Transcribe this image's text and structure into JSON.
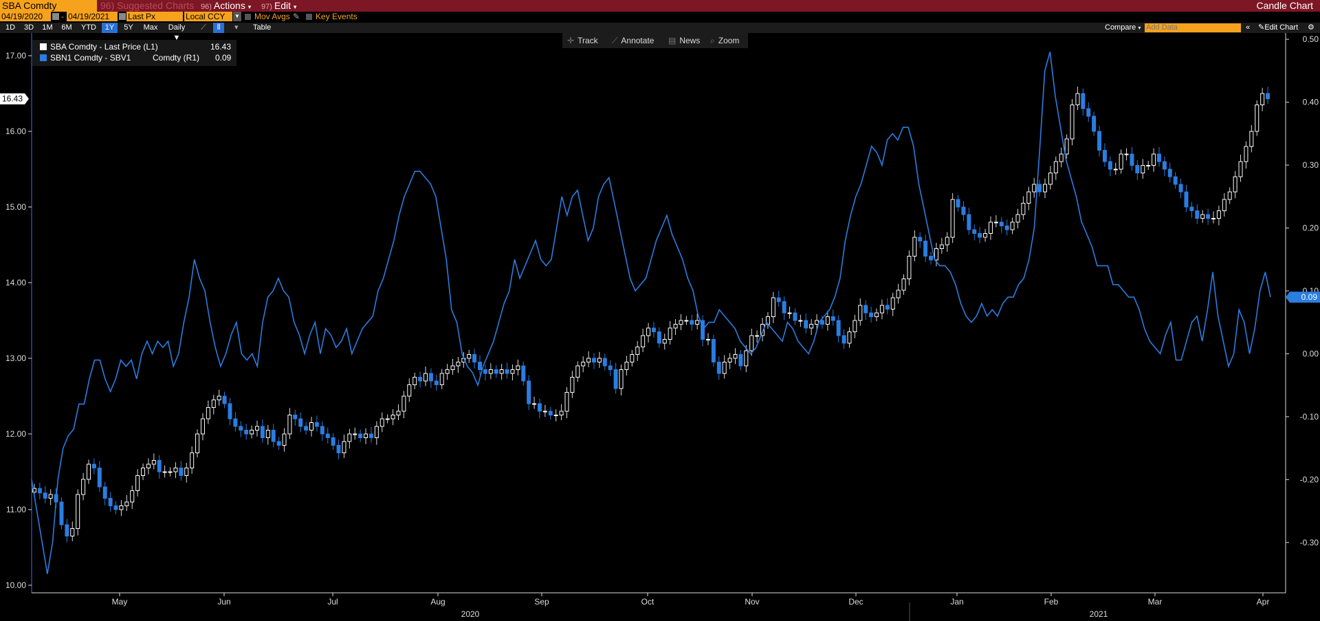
{
  "header": {
    "ticker": "SBA Comdty",
    "suggested_num": "96)",
    "suggested_label": "Suggested Charts",
    "actions_num": "96)",
    "actions_label": "Actions",
    "edit_num": "97)",
    "edit_label": "Edit",
    "title": "Candle Chart"
  },
  "options": {
    "start_date": "04/19/2020",
    "end_date": "04/19/2021",
    "field": "Last Px",
    "currency": "Local CCY",
    "mov_avgs": "Mov Avgs",
    "key_events": "Key Events"
  },
  "range_bar": {
    "ranges": [
      "1D",
      "3D",
      "1M",
      "6M",
      "YTD",
      "1Y",
      "5Y",
      "Max"
    ],
    "selected": "1Y",
    "frequency": "Daily",
    "table": "Table",
    "compare": "Compare",
    "add_data_placeholder": "Add Data",
    "edit_chart": "Edit Chart"
  },
  "toolbar": {
    "track": "Track",
    "annotate": "Annotate",
    "news": "News",
    "zoom": "Zoom"
  },
  "legend": [
    {
      "label": "SBA Comdty - Last Price (L1)",
      "value": "16.43",
      "color": "#ffffff"
    },
    {
      "label": "SBN1 Comdty - SBV1",
      "unit": "Comdty (R1)",
      "value": "0.09",
      "color": "#2a7de1"
    }
  ],
  "chart_data": {
    "type": "candlestick",
    "left_axis": {
      "ticks": [
        "10.00",
        "11.00",
        "12.00",
        "13.00",
        "14.00",
        "15.00",
        "16.00",
        "17.00"
      ],
      "range": [
        9.9,
        17.3
      ],
      "last_value_label": "16.43"
    },
    "right_axis": {
      "ticks": [
        "-0.30",
        "-0.20",
        "-0.10",
        "0.00",
        "0.10",
        "0.20",
        "0.30",
        "0.40",
        "0.50"
      ],
      "range": [
        -0.38,
        0.51
      ],
      "last_value_label": "0.09"
    },
    "x_months": [
      "May",
      "Jun",
      "Jul",
      "Aug",
      "Sep",
      "Oct",
      "Nov",
      "Dec",
      "Jan",
      "Feb",
      "Mar",
      "Apr"
    ],
    "x_years": [
      "2020",
      "2021"
    ],
    "series": [
      {
        "name": "SBA Comdty - Last Price (L1)",
        "axis": "left",
        "close": [
          11.28,
          11.22,
          11.15,
          11.2,
          11.1,
          10.8,
          10.65,
          10.75,
          11.2,
          11.4,
          11.6,
          11.55,
          11.3,
          11.15,
          11.05,
          11.0,
          11.05,
          11.1,
          11.25,
          11.45,
          11.55,
          11.6,
          11.65,
          11.5,
          11.5,
          11.5,
          11.55,
          11.45,
          11.55,
          11.75,
          12.0,
          12.2,
          12.35,
          12.45,
          12.5,
          12.4,
          12.2,
          12.1,
          12.05,
          12.0,
          12.05,
          12.1,
          11.95,
          12.05,
          11.9,
          11.85,
          12.0,
          12.25,
          12.2,
          12.1,
          12.05,
          12.15,
          12.1,
          12.0,
          11.95,
          11.85,
          11.75,
          11.9,
          12.0,
          12.0,
          11.95,
          12.0,
          11.95,
          12.1,
          12.2,
          12.2,
          12.25,
          12.3,
          12.5,
          12.65,
          12.75,
          12.7,
          12.8,
          12.7,
          12.65,
          12.8,
          12.85,
          12.9,
          12.95,
          13.0,
          13.05,
          12.95,
          12.85,
          12.8,
          12.85,
          12.8,
          12.85,
          12.8,
          12.85,
          12.9,
          12.7,
          12.4,
          12.4,
          12.3,
          12.3,
          12.25,
          12.25,
          12.3,
          12.55,
          12.75,
          12.9,
          12.95,
          13.0,
          12.95,
          13.0,
          12.9,
          12.85,
          12.6,
          12.85,
          12.95,
          13.05,
          13.15,
          13.3,
          13.4,
          13.35,
          13.2,
          13.25,
          13.4,
          13.45,
          13.5,
          13.5,
          13.45,
          13.5,
          13.25,
          13.25,
          12.95,
          12.8,
          12.95,
          13.0,
          13.05,
          12.9,
          13.1,
          13.3,
          13.3,
          13.45,
          13.55,
          13.8,
          13.75,
          13.6,
          13.6,
          13.5,
          13.5,
          13.4,
          13.45,
          13.5,
          13.45,
          13.55,
          13.5,
          13.3,
          13.2,
          13.35,
          13.5,
          13.7,
          13.6,
          13.55,
          13.6,
          13.7,
          13.65,
          13.8,
          13.9,
          14.05,
          14.35,
          14.6,
          14.55,
          14.35,
          14.3,
          14.45,
          14.5,
          14.6,
          15.1,
          15.0,
          14.9,
          14.7,
          14.65,
          14.6,
          14.65,
          14.8,
          14.8,
          14.75,
          14.7,
          14.8,
          14.9,
          15.05,
          15.2,
          15.3,
          15.2,
          15.3,
          15.45,
          15.6,
          15.7,
          15.9,
          16.35,
          16.5,
          16.3,
          16.2,
          16.0,
          15.75,
          15.6,
          15.5,
          15.5,
          15.7,
          15.7,
          15.55,
          15.45,
          15.55,
          15.55,
          15.7,
          15.6,
          15.5,
          15.4,
          15.3,
          15.2,
          15.0,
          14.95,
          14.85,
          14.9,
          14.85,
          14.85,
          14.95,
          15.1,
          15.2,
          15.4,
          15.6,
          15.8,
          16.0,
          16.35,
          16.5,
          16.43
        ],
        "up_color": "#ffffff",
        "down_color": "#2a7de1"
      },
      {
        "name": "SBN1 Comdty - SBV1",
        "axis": "right",
        "values": [
          -0.2,
          -0.25,
          -0.3,
          -0.35,
          -0.3,
          -0.2,
          -0.15,
          -0.13,
          -0.12,
          -0.08,
          -0.08,
          -0.04,
          -0.01,
          -0.01,
          -0.04,
          -0.06,
          -0.04,
          -0.01,
          -0.02,
          -0.01,
          -0.04,
          0.0,
          0.02,
          0.0,
          0.02,
          0.01,
          0.02,
          -0.02,
          0.0,
          0.05,
          0.09,
          0.15,
          0.12,
          0.1,
          0.05,
          0.01,
          -0.02,
          0.0,
          0.03,
          0.05,
          0.0,
          -0.01,
          0.0,
          -0.02,
          0.05,
          0.09,
          0.1,
          0.12,
          0.1,
          0.09,
          0.05,
          0.03,
          0.0,
          0.03,
          0.05,
          0.0,
          0.04,
          0.03,
          0.01,
          0.02,
          0.04,
          0.0,
          0.02,
          0.04,
          0.05,
          0.06,
          0.1,
          0.12,
          0.15,
          0.18,
          0.22,
          0.25,
          0.27,
          0.29,
          0.29,
          0.28,
          0.27,
          0.25,
          0.2,
          0.15,
          0.07,
          0.05,
          0.0,
          -0.02,
          -0.03,
          -0.05,
          -0.02,
          0.0,
          0.02,
          0.05,
          0.08,
          0.1,
          0.15,
          0.12,
          0.14,
          0.16,
          0.18,
          0.15,
          0.14,
          0.15,
          0.2,
          0.25,
          0.22,
          0.25,
          0.26,
          0.22,
          0.18,
          0.2,
          0.25,
          0.27,
          0.28,
          0.24,
          0.2,
          0.16,
          0.12,
          0.1,
          0.11,
          0.12,
          0.15,
          0.18,
          0.2,
          0.22,
          0.19,
          0.17,
          0.15,
          0.12,
          0.1,
          0.06,
          0.04,
          0.05,
          0.05,
          0.07,
          0.06,
          0.05,
          0.04,
          0.02,
          0.01,
          0.0,
          0.01,
          0.03,
          0.05,
          0.04,
          0.03,
          0.02,
          0.05,
          0.04,
          0.02,
          0.01,
          0.0,
          0.02,
          0.05,
          0.06,
          0.07,
          0.09,
          0.12,
          0.18,
          0.22,
          0.25,
          0.27,
          0.3,
          0.33,
          0.32,
          0.3,
          0.34,
          0.35,
          0.34,
          0.36,
          0.36,
          0.33,
          0.27,
          0.23,
          0.19,
          0.15,
          0.14,
          0.14,
          0.13,
          0.11,
          0.08,
          0.06,
          0.05,
          0.06,
          0.08,
          0.06,
          0.07,
          0.06,
          0.08,
          0.09,
          0.09,
          0.11,
          0.12,
          0.15,
          0.2,
          0.32,
          0.45,
          0.48,
          0.41,
          0.36,
          0.31,
          0.28,
          0.25,
          0.21,
          0.19,
          0.17,
          0.14,
          0.14,
          0.14,
          0.11,
          0.11,
          0.1,
          0.09,
          0.09,
          0.07,
          0.04,
          0.02,
          0.01,
          0.0,
          0.03,
          0.05,
          -0.01,
          -0.01,
          0.02,
          0.05,
          0.06,
          0.02,
          0.07,
          0.13,
          0.06,
          0.02,
          -0.02,
          0.0,
          0.07,
          0.05,
          0.0,
          0.04,
          0.1,
          0.13,
          0.09
        ],
        "color": "#2a7de1"
      }
    ],
    "grid": false
  }
}
